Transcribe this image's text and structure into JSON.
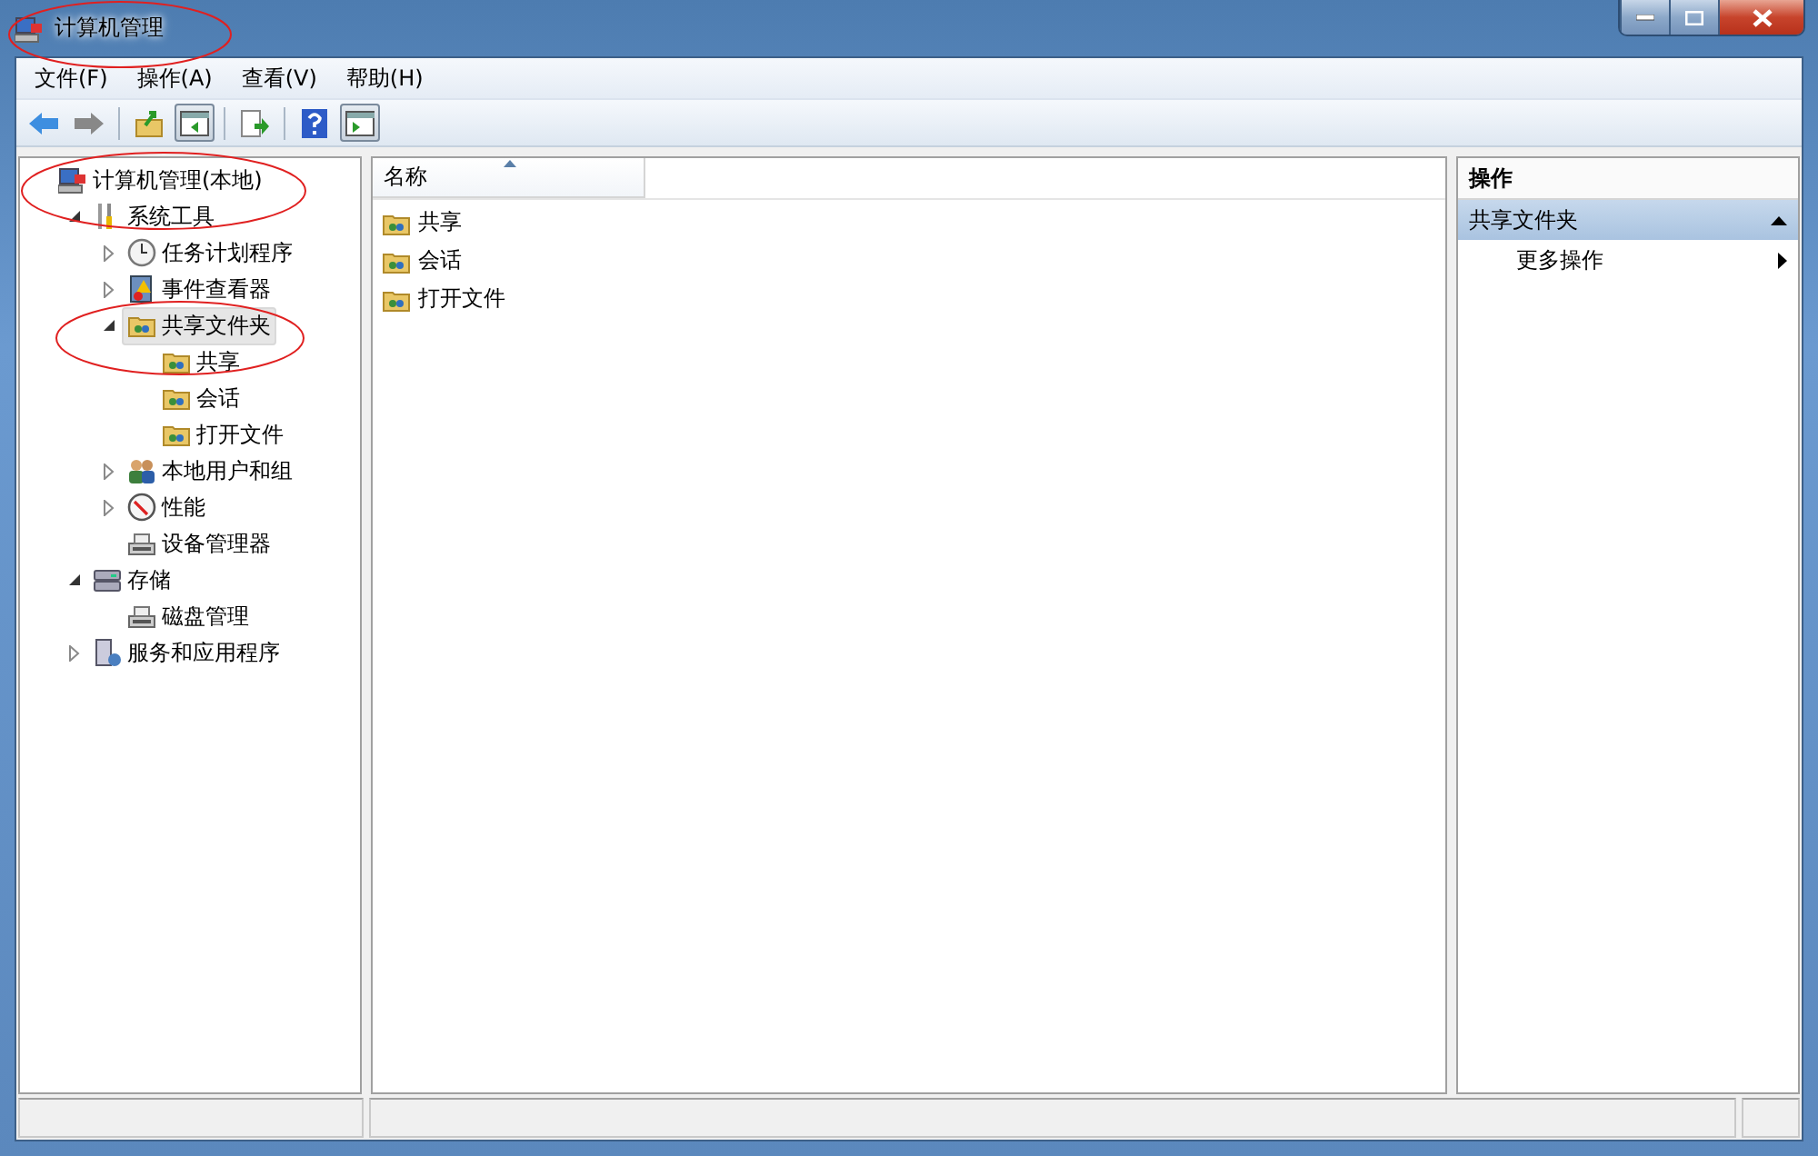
{
  "window": {
    "title": "计算机管理"
  },
  "menu": [
    "文件(F)",
    "操作(A)",
    "查看(V)",
    "帮助(H)"
  ],
  "tree": [
    {
      "label": "计算机管理(本地)",
      "kind": "computer",
      "selected": false,
      "children": [
        {
          "label": "系统工具",
          "kind": "tools",
          "expanded": true,
          "selected": false,
          "children": [
            {
              "label": "任务计划程序",
              "kind": "clock",
              "expanded": false,
              "selected": false
            },
            {
              "label": "事件查看器",
              "kind": "event",
              "expanded": false,
              "selected": false
            },
            {
              "label": "共享文件夹",
              "kind": "share",
              "expanded": true,
              "selected": true,
              "children": [
                {
                  "label": "共享",
                  "kind": "share",
                  "selected": false
                },
                {
                  "label": "会话",
                  "kind": "share",
                  "selected": false
                },
                {
                  "label": "打开文件",
                  "kind": "share",
                  "selected": false
                }
              ]
            },
            {
              "label": "本地用户和组",
              "kind": "users",
              "expanded": false,
              "selected": false
            },
            {
              "label": "性能",
              "kind": "perf",
              "expanded": false,
              "selected": false
            },
            {
              "label": "设备管理器",
              "kind": "device",
              "selected": false
            }
          ]
        },
        {
          "label": "存储",
          "kind": "storage",
          "expanded": true,
          "selected": false,
          "children": [
            {
              "label": "磁盘管理",
              "kind": "device",
              "selected": false
            }
          ]
        },
        {
          "label": "服务和应用程序",
          "kind": "services",
          "expanded": false,
          "selected": false
        }
      ]
    }
  ],
  "list": {
    "columns": [
      "名称"
    ],
    "rows": [
      "共享",
      "会话",
      "打开文件"
    ]
  },
  "actions": {
    "heading": "操作",
    "sections": [
      {
        "title": "共享文件夹",
        "expanded": true,
        "items": [
          "更多操作"
        ]
      }
    ]
  }
}
